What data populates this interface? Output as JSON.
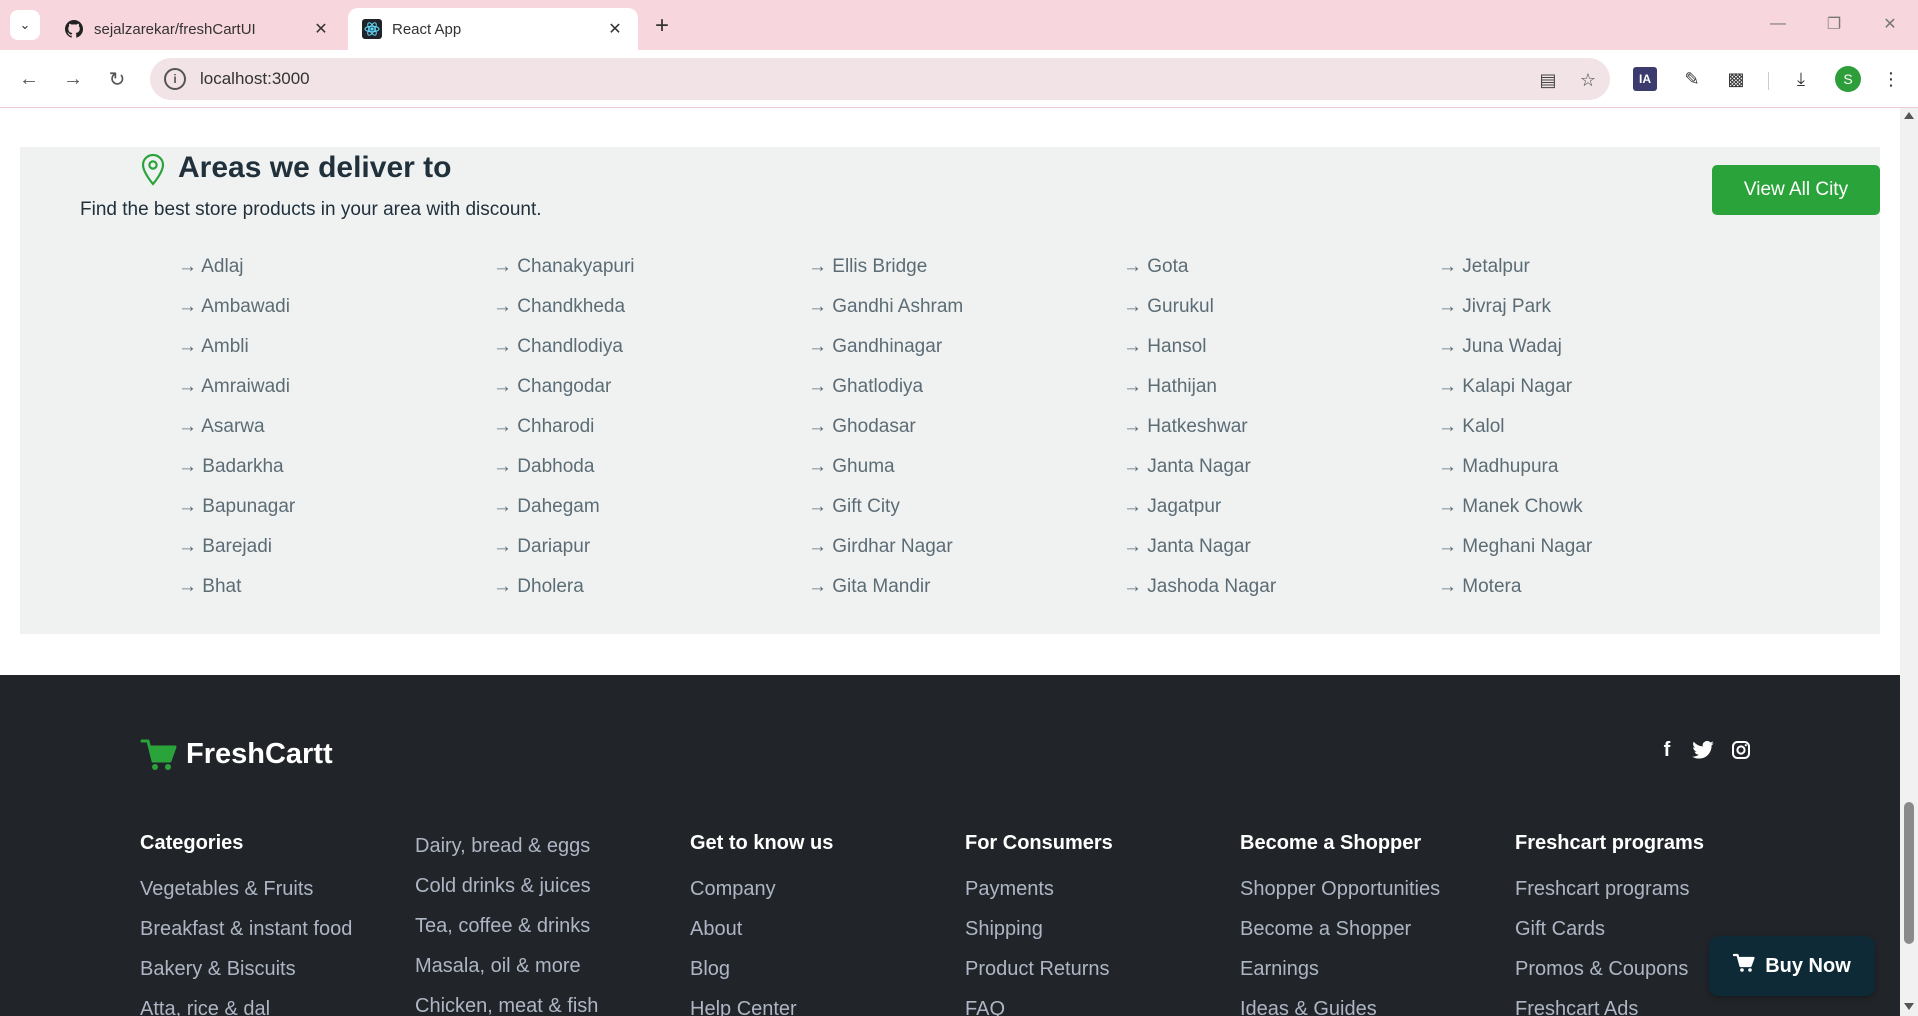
{
  "browser": {
    "tabs": [
      {
        "label": "sejalzarekar/freshCartUI",
        "favicon": "github-icon"
      },
      {
        "label": "React App",
        "favicon": "react-icon"
      }
    ],
    "url": "localhost:3000"
  },
  "areas": {
    "title": "Areas we deliver to",
    "subtitle": "Find the best store products in your area with discount.",
    "view_all_label": "View All City",
    "columns": [
      [
        "→ Adlaj",
        "→ Ambawadi",
        "→ Ambli",
        "→ Amraiwadi",
        "→ Asarwa",
        "→ Badarkha",
        "→ Bapunagar",
        "→ Barejadi",
        "→ Bhat"
      ],
      [
        "→ Chanakyapuri",
        "→ Chandkheda",
        "→ Chandlodiya",
        "→ Changodar",
        "→ Chharodi",
        "→ Dabhoda",
        "→ Dahegam",
        "→ Dariapur",
        "→ Dholera"
      ],
      [
        "→ Ellis Bridge",
        "→ Gandhi Ashram",
        "→ Gandhinagar",
        "→ Ghatlodiya",
        "→ Ghodasar",
        "→ Ghuma",
        "→ Gift City",
        "→ Girdhar Nagar",
        "→ Gita Mandir"
      ],
      [
        "→ Gota",
        "→ Gurukul",
        "→ Hansol",
        "→ Hathijan",
        "→ Hatkeshwar",
        "→ Janta Nagar",
        "→ Jagatpur",
        "→ Janta Nagar",
        "→ Jashoda Nagar"
      ],
      [
        "→ Jetalpur",
        "→ Jivraj Park",
        "→ Juna Wadaj",
        "→ Kalapi Nagar",
        "→ Kalol",
        "→ Madhupura",
        "→ Manek Chowk",
        "→ Meghani Nagar",
        "→ Motera"
      ]
    ]
  },
  "footer": {
    "brand": "FreshCartt",
    "social_icons": [
      "facebook-icon",
      "twitter-icon",
      "instagram-icon"
    ],
    "columns": [
      {
        "heading": "Categories",
        "links": [
          "Vegetables & Fruits",
          "Breakfast & instant food",
          "Bakery & Biscuits",
          "Atta, rice & dal"
        ]
      },
      {
        "heading": "",
        "links": [
          "Dairy, bread & eggs",
          "Cold drinks & juices",
          "Tea, coffee & drinks",
          "Masala, oil & more",
          "Chicken, meat & fish"
        ]
      },
      {
        "heading": "Get to know us",
        "links": [
          "Company",
          "About",
          "Blog",
          "Help Center"
        ]
      },
      {
        "heading": "For Consumers",
        "links": [
          "Payments",
          "Shipping",
          "Product Returns",
          "FAQ"
        ]
      },
      {
        "heading": "Become a Shopper",
        "links": [
          "Shopper Opportunities",
          "Become a Shopper",
          "Earnings",
          "Ideas & Guides"
        ]
      },
      {
        "heading": "Freshcart programs",
        "links": [
          "Freshcart programs",
          "Gift Cards",
          "Promos & Coupons",
          "Freshcart Ads"
        ]
      }
    ]
  },
  "buy_now_label": "Buy Now",
  "colors": {
    "accent": "#2aa33a",
    "footer_bg": "#212529",
    "section_bg": "#f0f2f2",
    "tab_strip": "#f7d7dd"
  }
}
